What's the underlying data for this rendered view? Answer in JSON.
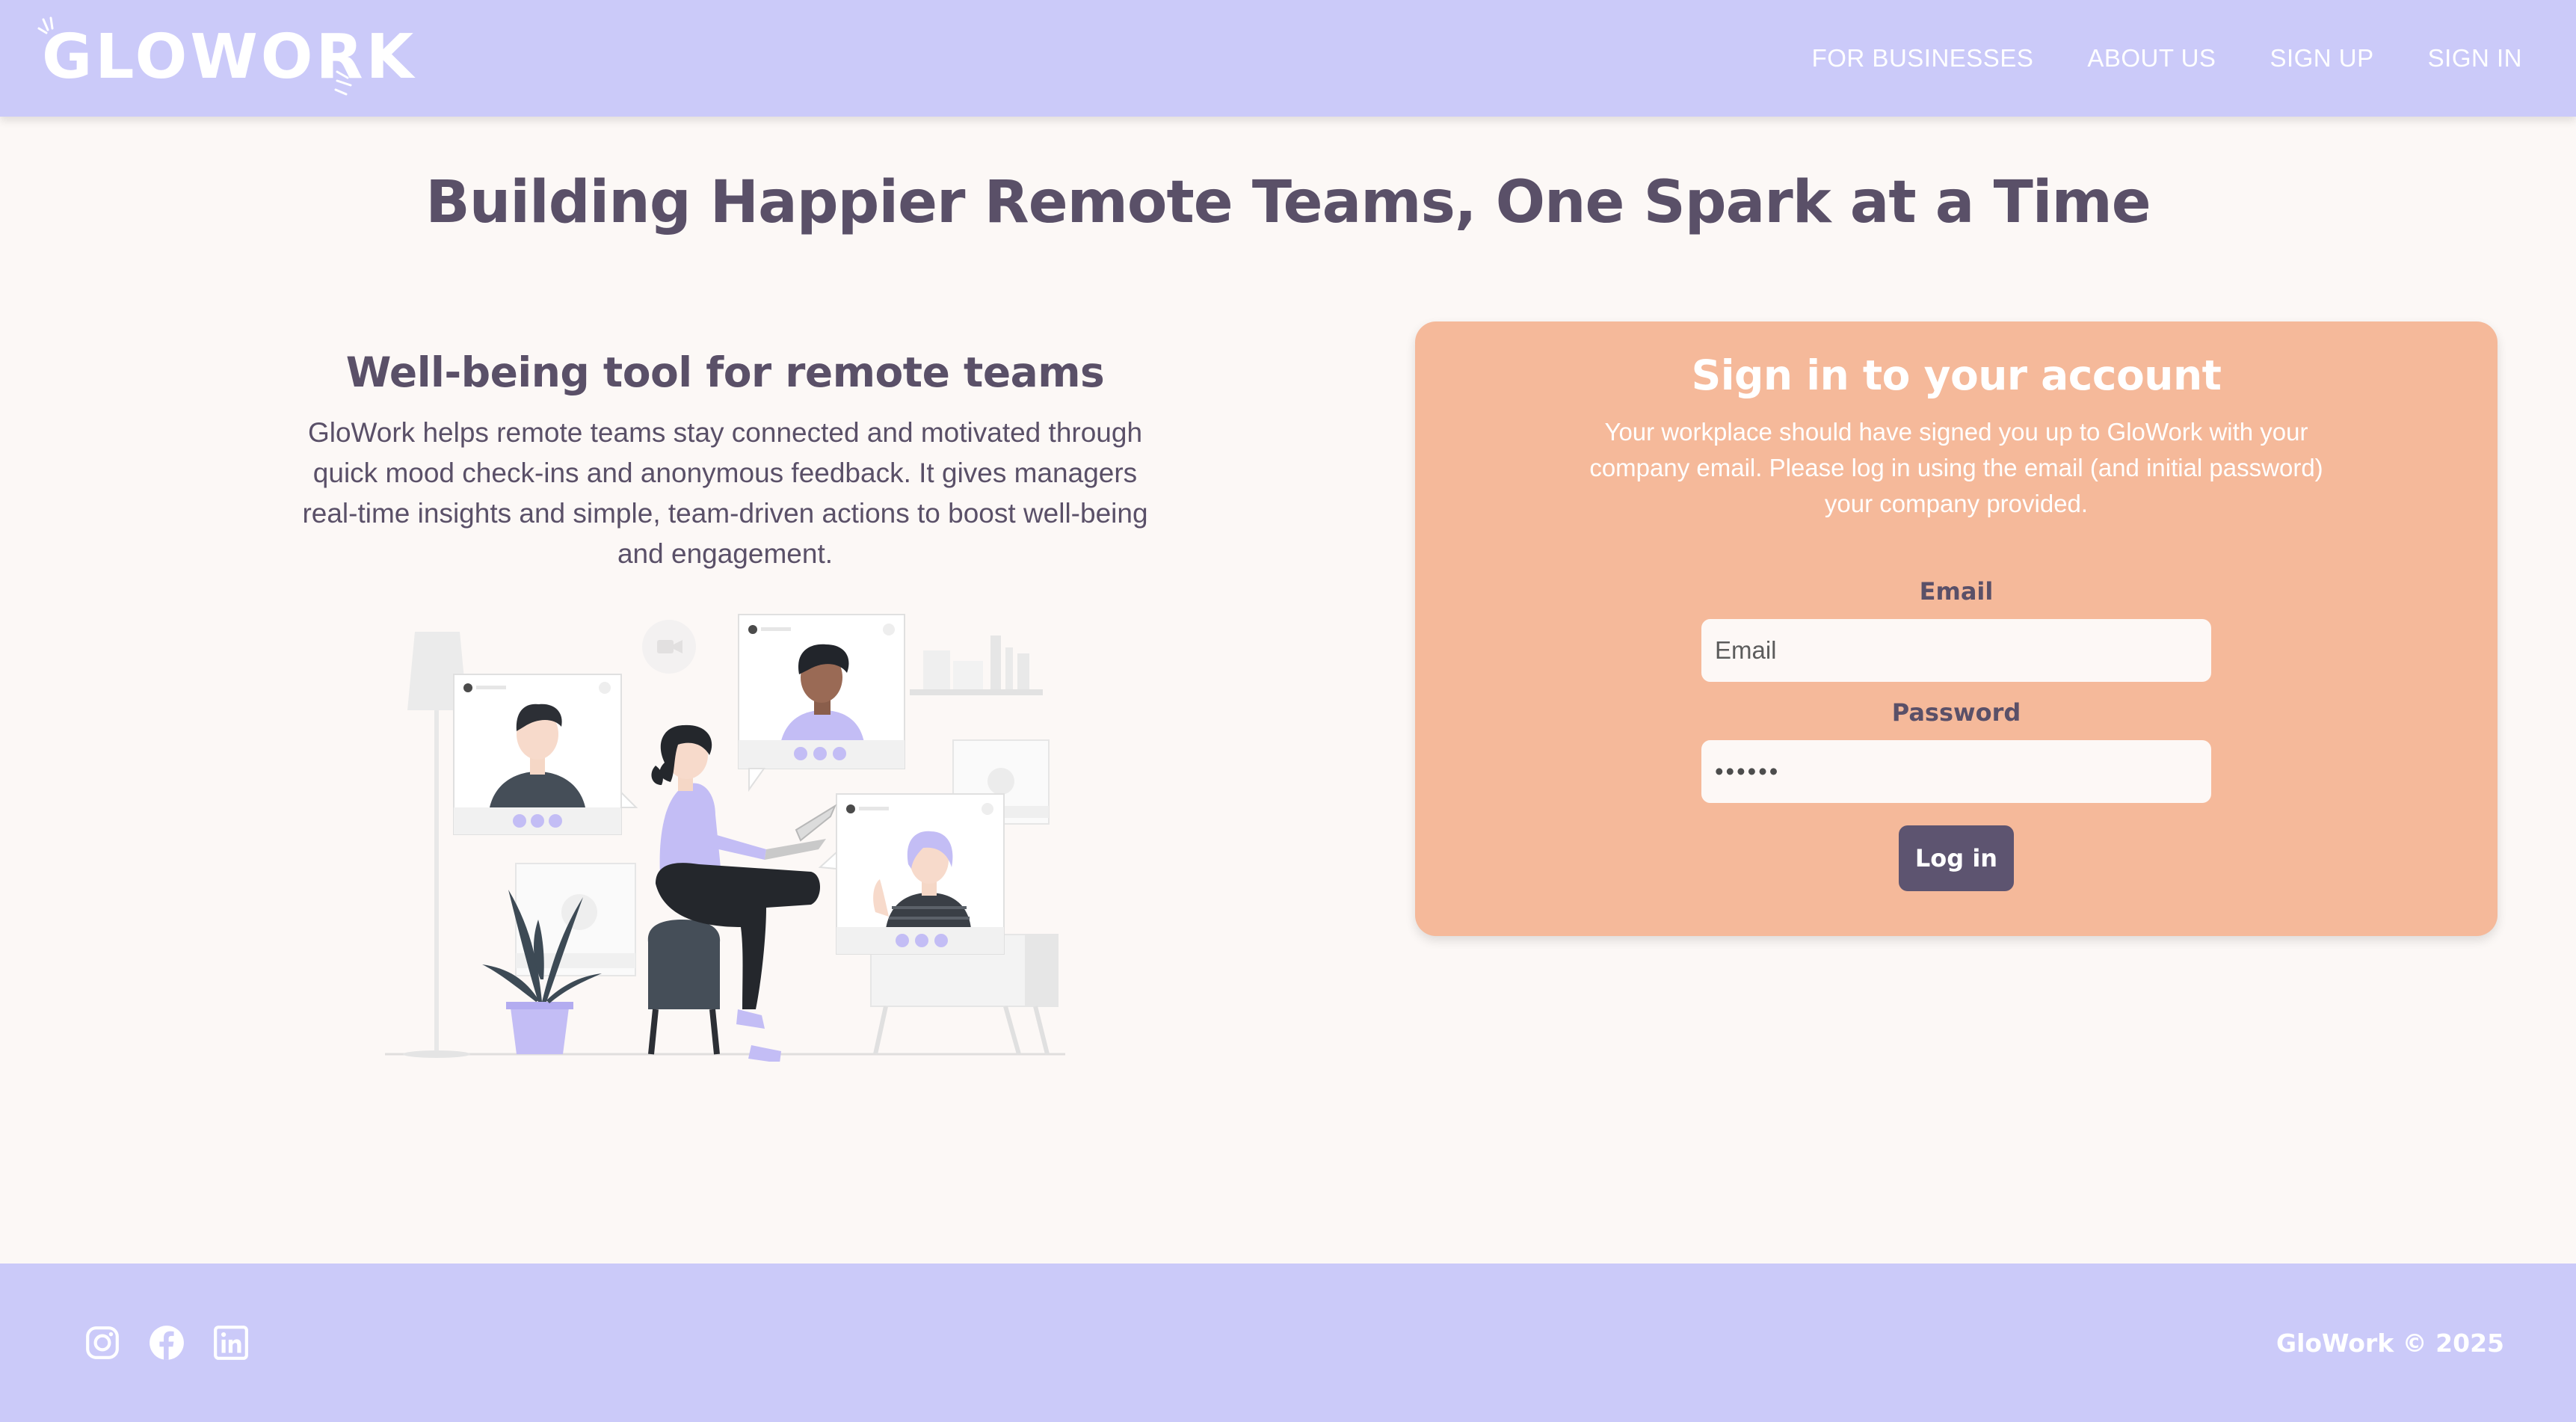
{
  "brand": {
    "logo_text": "GLOWORK"
  },
  "nav": {
    "items": [
      {
        "label": "FOR BUSINESSES"
      },
      {
        "label": "ABOUT US"
      },
      {
        "label": "SIGN UP"
      },
      {
        "label": "SIGN IN"
      }
    ]
  },
  "hero": {
    "title": "Building Happier Remote Teams, One Spark at a Time"
  },
  "info": {
    "title": "Well-being tool for remote teams",
    "text": "GloWork helps remote teams stay connected and motivated through quick mood check-ins and anonymous feedback. It gives managers real-time insights and simple, team-driven actions to boost well-being and engagement."
  },
  "signin": {
    "title": "Sign in to your account",
    "description": "Your workplace should have signed you up to GloWork with your company email. Please log in using the email (and initial password) your company provided.",
    "email_label": "Email",
    "email_placeholder": "Email",
    "email_value": "",
    "password_label": "Password",
    "password_value": "••••••",
    "login_label": "Log in"
  },
  "footer": {
    "social_icons": [
      "instagram-icon",
      "facebook-icon",
      "linkedin-icon"
    ],
    "copyright": "GloWork © 2025"
  },
  "colors": {
    "nav_bg": "#cbcaf9",
    "page_bg": "#fcf8f6",
    "card_bg": "#f5b99a",
    "text_dark": "#5a5068",
    "button_bg": "#5d5470",
    "accent_lilac": "#c3bdf5"
  }
}
